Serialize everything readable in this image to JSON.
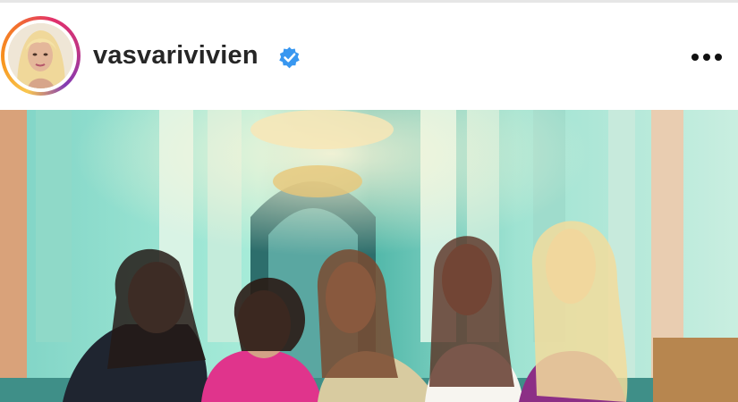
{
  "post": {
    "username": "vasvarivivien",
    "verified": true,
    "icons": {
      "verified": "verified-badge-icon",
      "more": "more-options-icon"
    },
    "colors": {
      "verified_badge": "#3897f0",
      "text": "#262626",
      "story_ring": [
        "#f9c74f",
        "#f3722c",
        "#e1306c",
        "#c13584",
        "#833ab4"
      ]
    }
  }
}
